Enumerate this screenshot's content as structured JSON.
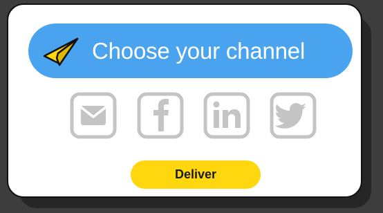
{
  "header": {
    "title": "Choose your channel",
    "icon": "paper-plane-icon",
    "background": "#4aa3ef",
    "text_color": "#ffffff"
  },
  "channels": [
    {
      "name": "email",
      "icon": "mail-icon"
    },
    {
      "name": "facebook",
      "icon": "facebook-icon"
    },
    {
      "name": "linkedin",
      "icon": "linkedin-icon"
    },
    {
      "name": "twitter",
      "icon": "twitter-icon"
    }
  ],
  "channel_icon_color": "#c4c4c4",
  "deliver_button": {
    "label": "Deliver",
    "background": "#ffd70f"
  }
}
